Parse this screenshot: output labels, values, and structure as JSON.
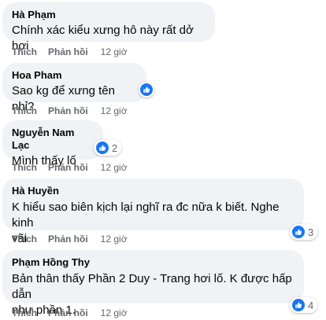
{
  "comments": [
    {
      "author": "Hà Phạm",
      "text": "Chính xác kiểu xưng hô này rất dở hơi",
      "like_label": "Thích",
      "reply_label": "Phản hồi",
      "time": "12 giờ"
    },
    {
      "author": "Hoa Pham",
      "text": "Sao kg để xưng tên nhỉ?",
      "like_label": "Thích",
      "reply_label": "Phản hồi",
      "time": "12 giờ"
    },
    {
      "author": "Nguyễn Nam Lạc",
      "text": "Mình thấy lố",
      "reaction_count": "2",
      "like_label": "Thích",
      "reply_label": "Phản hồi",
      "time": "12 giờ"
    },
    {
      "author": "Hà Huyền",
      "text_line1": "K hiểu sao biên kịch lại nghĩ ra đc nữa k biết. Nghe kinh",
      "text_line2": "vãi",
      "reaction_count": "3",
      "like_label": "Thích",
      "reply_label": "Phản hồi",
      "time": "12 giờ"
    },
    {
      "author": "Phạm Hồng Thy",
      "text_line1": "Bản thân thấy Phần 2 Duy - Trang hơi lố. K được hấp dẫn",
      "text_line2": "như phần 1.",
      "reaction_count": "4",
      "like_label": "Thích",
      "reply_label": "Phản hồi",
      "time": "12 giờ"
    }
  ],
  "colors": {
    "bubble": "#f0f2f5",
    "meta_text": "#65676b",
    "like_blue": "#1877f2"
  },
  "icons": {
    "reaction": "like-thumb-icon"
  }
}
